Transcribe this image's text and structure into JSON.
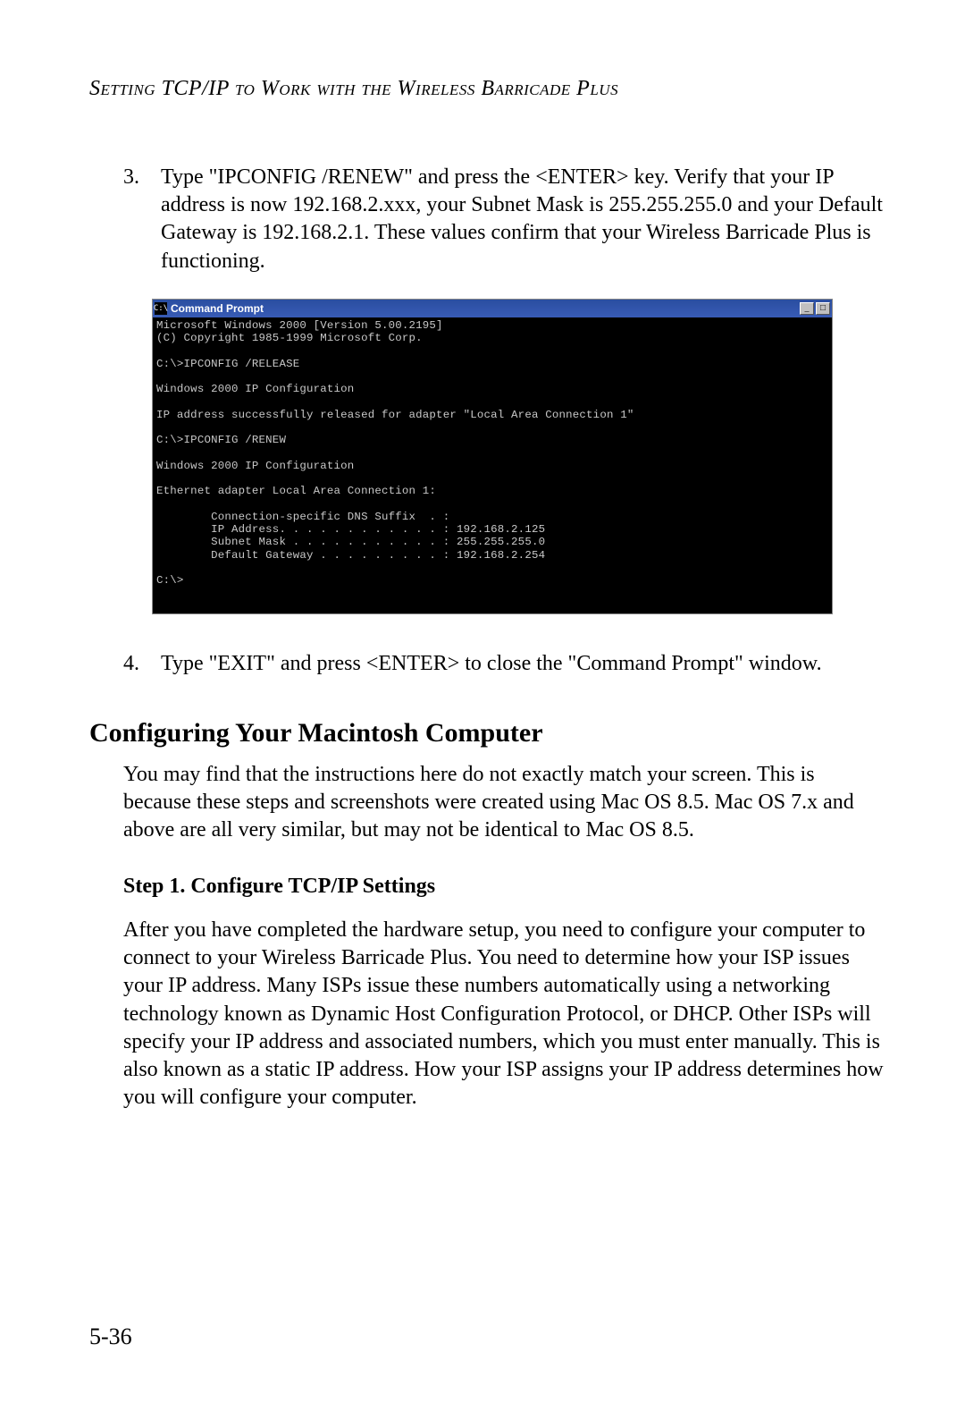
{
  "header": "Setting TCP/IP to Work with the Wireless Barricade Plus",
  "steps": {
    "s3": {
      "num": "3.",
      "text": "Type \"IPCONFIG /RENEW\" and press the <ENTER> key. Verify that your IP address is now 192.168.2.xxx, your Subnet Mask is 255.255.255.0 and your Default Gateway is 192.168.2.1. These values confirm that your Wireless Barricade Plus is functioning."
    },
    "s4": {
      "num": "4.",
      "text": "Type \"EXIT\" and press <ENTER> to close the \"Command Prompt\" window."
    }
  },
  "cmd": {
    "icon_text": "C:\\",
    "title": "Command Prompt",
    "btn_min": "_",
    "btn_max": "□",
    "body": "Microsoft Windows 2000 [Version 5.00.2195]\n(C) Copyright 1985-1999 Microsoft Corp.\n\nC:\\>IPCONFIG /RELEASE\n\nWindows 2000 IP Configuration\n\nIP address successfully released for adapter \"Local Area Connection 1\"\n\nC:\\>IPCONFIG /RENEW\n\nWindows 2000 IP Configuration\n\nEthernet adapter Local Area Connection 1:\n\n        Connection-specific DNS Suffix  . :\n        IP Address. . . . . . . . . . . . : 192.168.2.125\n        Subnet Mask . . . . . . . . . . . : 255.255.255.0\n        Default Gateway . . . . . . . . . : 192.168.2.254\n\nC:\\>"
  },
  "section2": {
    "heading": "Configuring Your Macintosh Computer",
    "intro": "You may find that the instructions here do not exactly match your screen. This is because these steps and screenshots were created using Mac OS 8.5. Mac OS 7.x and above are all very similar, but may not be identical to Mac OS 8.5.",
    "step1_heading": "Step 1. Configure TCP/IP Settings",
    "step1_body": "After you have completed the hardware setup, you need to configure your computer to connect to your Wireless Barricade Plus. You need to determine how your ISP issues your IP address. Many ISPs issue these numbers automatically using a networking technology known as Dynamic Host Configuration Protocol, or DHCP. Other ISPs will specify your IP address and associated numbers, which you must enter manually. This is also known as a static IP address. How your ISP assigns your IP address determines how you will configure your computer."
  },
  "page_number": "5-36"
}
